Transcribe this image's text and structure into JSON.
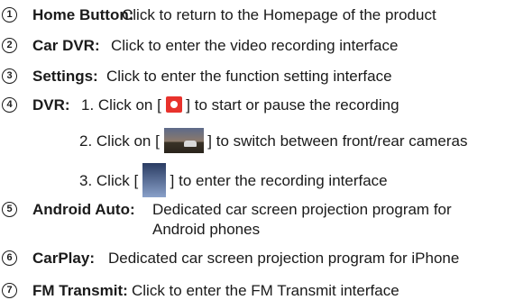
{
  "items": [
    {
      "num": "1",
      "label": "Home Button:",
      "desc": "Click to return to the Homepage of the product"
    },
    {
      "num": "2",
      "label": "Car DVR:",
      "desc": "Click to enter the video recording interface"
    },
    {
      "num": "3",
      "label": "Settings:",
      "desc": "Click to enter the function setting interface"
    },
    {
      "num": "4",
      "label": "DVR:"
    },
    {
      "num": "5",
      "label": "Android Auto:",
      "desc": "Dedicated car screen projection program for",
      "desc2": "Android phones"
    },
    {
      "num": "6",
      "label": "CarPlay:",
      "desc": "Dedicated car screen projection program for iPhone"
    },
    {
      "num": "7",
      "label": "FM Transmit:",
      "desc": "Click to enter the FM Transmit interface"
    }
  ],
  "dvr_steps": [
    {
      "pre": "1. Click on [",
      "post": "]  to start or pause the recording",
      "icon": "record-icon"
    },
    {
      "pre": "2. Click on [",
      "post": "]  to switch between front/rear cameras",
      "icon": "camera-thumbnail-icon"
    },
    {
      "pre": "3. Click [",
      "post": "] to enter the recording interface",
      "icon": "recording-list-icon"
    }
  ]
}
